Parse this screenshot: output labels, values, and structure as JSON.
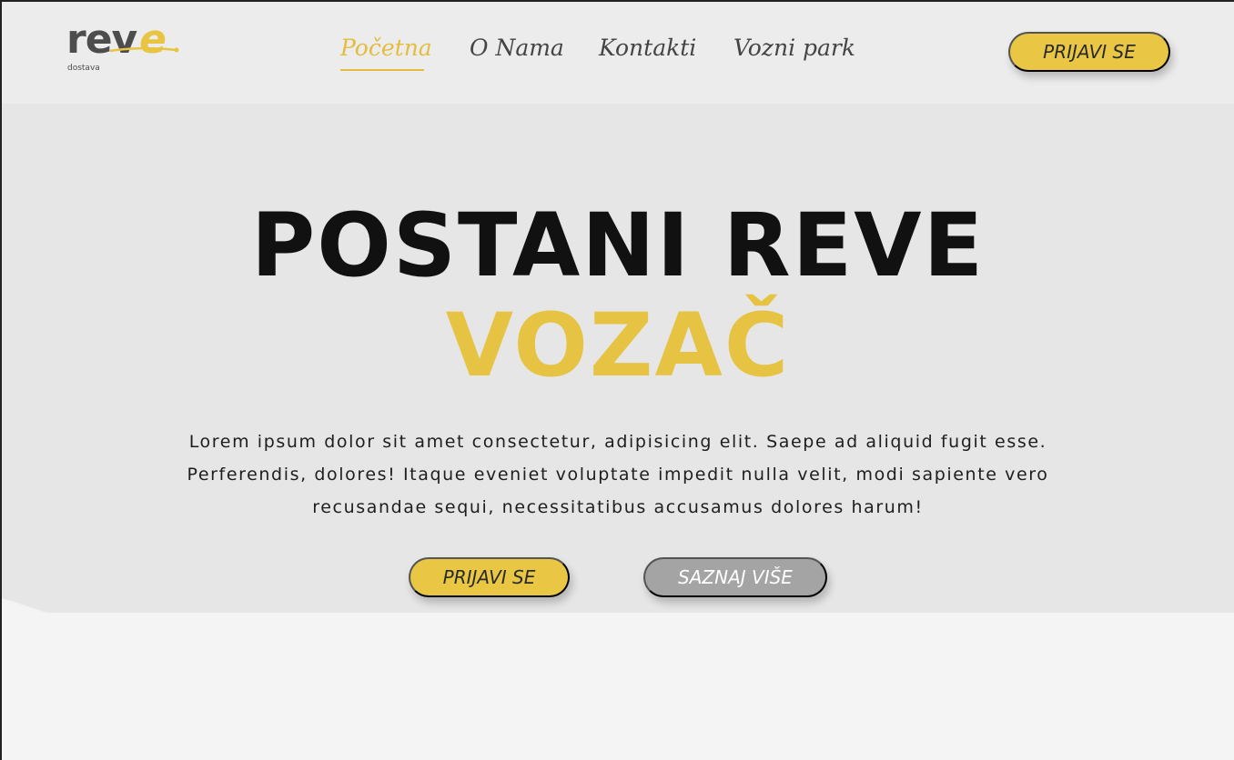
{
  "brand": {
    "logo_text": "reve",
    "logo_sub": "dostava"
  },
  "nav": {
    "links": [
      "Početna",
      "O Nama",
      "Kontakti",
      "Vozni park"
    ],
    "active_index": 0,
    "cta": "PRIJAVI SE"
  },
  "hero": {
    "title_line1": "POSTANI REVE",
    "title_line2": "VOZAČ",
    "description": "Lorem ipsum dolor sit amet consectetur, adipisicing elit. Saepe ad aliquid fugit esse. Perferendis, dolores! Itaque eveniet voluptate impedit nulla velit, modi sapiente vero recusandae sequi, necessitatibus accusamus dolores harum!",
    "primary_button": "PRIJAVI SE",
    "secondary_button": "SAZNAJ VIŠE"
  },
  "colors": {
    "accent": "#e6c343",
    "text_dark": "#111111",
    "nav_text": "#444444",
    "secondary_button": "#a4a4a4",
    "hero_bg": "#e6e6e6",
    "page_bg": "#f4f4f4"
  }
}
